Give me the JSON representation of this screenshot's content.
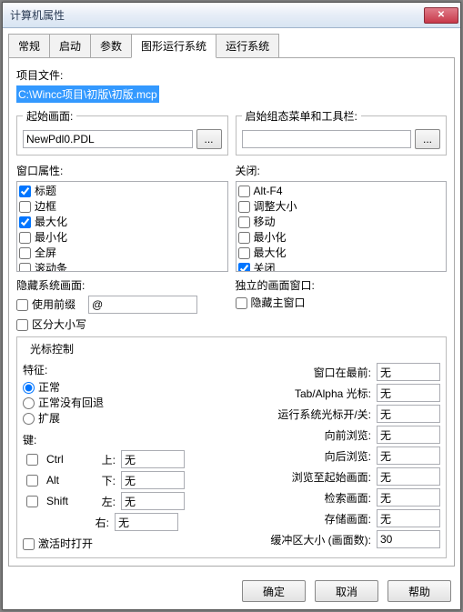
{
  "title": "计算机属性",
  "tabs": [
    "常规",
    "启动",
    "参数",
    "图形运行系统",
    "运行系统"
  ],
  "activeTab": 3,
  "projFileLabel": "项目文件:",
  "projFile": "C:\\Wincc项目\\初版\\初版.mcp",
  "startScreen": {
    "legend": "起始画面:",
    "value": "NewPdl0.PDL",
    "browse": "..."
  },
  "startMenu": {
    "legend": "启始组态菜单和工具栏:",
    "value": "",
    "browse": "..."
  },
  "winAttr": {
    "label": "窗口属性:",
    "items": [
      {
        "t": "标题",
        "c": true
      },
      {
        "t": "边框",
        "c": false
      },
      {
        "t": "最大化",
        "c": true
      },
      {
        "t": "最小化",
        "c": false
      },
      {
        "t": "全屏",
        "c": false
      },
      {
        "t": "滚动条",
        "c": false
      }
    ]
  },
  "closeOpt": {
    "label": "关闭:",
    "items": [
      {
        "t": "Alt-F4",
        "c": false
      },
      {
        "t": "调整大小",
        "c": false
      },
      {
        "t": "移动",
        "c": false
      },
      {
        "t": "最小化",
        "c": false
      },
      {
        "t": "最大化",
        "c": false
      },
      {
        "t": "关闭",
        "c": true
      }
    ]
  },
  "hideSys": {
    "label": "隐藏系统画面:",
    "prefix": "使用前缀",
    "at": "@"
  },
  "indep": {
    "label": "独立的画面窗口:",
    "hide": "隐藏主窗口"
  },
  "caseSensitive": "区分大小写",
  "cursor": {
    "legend": "光标控制",
    "featLabel": "特征:",
    "r1": "正常",
    "r2": "正常没有回退",
    "r3": "扩展",
    "keysLabel": "键:",
    "ctrl": "Ctrl",
    "alt": "Alt",
    "shift": "Shift",
    "up": "上:",
    "down": "下:",
    "left": "左:",
    "right": "右:",
    "none": "无",
    "activate": "激活时打开",
    "right_rows": [
      {
        "l": "窗口在最前:",
        "v": "无"
      },
      {
        "l": "Tab/Alpha 光标:",
        "v": "无"
      },
      {
        "l": "运行系统光标开/关:",
        "v": "无"
      },
      {
        "l": "向前浏览:",
        "v": "无"
      },
      {
        "l": "向后浏览:",
        "v": "无"
      },
      {
        "l": "浏览至起始画面:",
        "v": "无"
      },
      {
        "l": "检索画面:",
        "v": "无"
      },
      {
        "l": "存储画面:",
        "v": "无"
      },
      {
        "l": "缓冲区大小 (画面数):",
        "v": "30"
      }
    ]
  },
  "buttons": {
    "ok": "确定",
    "cancel": "取消",
    "help": "帮助"
  }
}
